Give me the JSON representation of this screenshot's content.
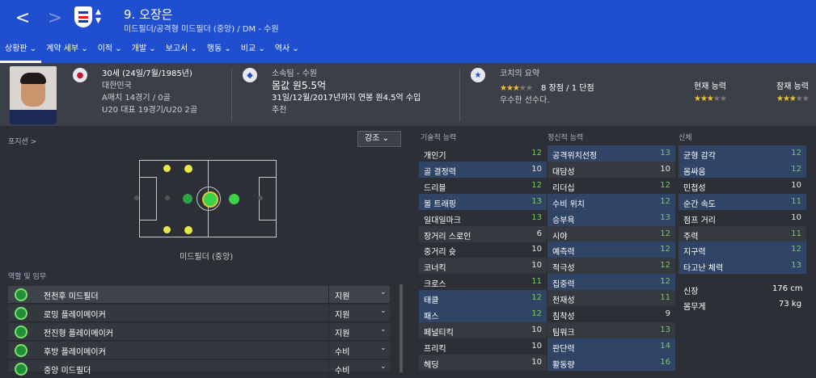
{
  "header": {
    "back_label": "<",
    "forward_label": ">",
    "chevron": "^ v",
    "player_name": "9. 오장은",
    "player_sub": "미드필더/공격형 미드필더 (중앙) / DM - 수원"
  },
  "tabs": [
    "상황판 ⌄",
    "계약 세부 ⌄",
    "이적 ⌄",
    "개발 ⌄",
    "보고서 ⌄",
    "행동 ⌄",
    "비교 ⌄",
    "역사 ⌄"
  ],
  "profile": {
    "age": "30세 (24일/7월/1985년)",
    "nation": "대한민국",
    "a_caps": "A매치 14경기 / 0골",
    "u20_caps": "U20 대표 19경기/U20 2골",
    "club_label": "소속팀 - 수원",
    "value": "몸값 원5.5억",
    "contract": "31일/12월/2017년까지 연봉 원4.5억 수입",
    "recommend": "추천"
  },
  "coach": {
    "title": "코치의 요약",
    "stars": "★★★",
    "stars_dim": "★★",
    "summary": "8 장점 / 1 단점",
    "comment": "우수한 선수다.",
    "current_ability_label": "현재 능력",
    "potential_ability_label": "잠재 능력",
    "current_stars": "★★★",
    "current_stars_dim": "★★",
    "potential_stars": "★★★",
    "potential_stars_dim": "★★"
  },
  "position": {
    "section_title": "포지션 >",
    "dropdown_label": "강조 ⌄",
    "position_label": "미드필더 (중앙)"
  },
  "roles": {
    "section_title": "역할 및 임무",
    "items": [
      {
        "name": "전천후 미드필더",
        "duty": "지원"
      },
      {
        "name": "로밍 플레이메이커",
        "duty": "지원"
      },
      {
        "name": "전진형 플레이메이커",
        "duty": "지원"
      },
      {
        "name": "후방 플레이메이커",
        "duty": "수비"
      },
      {
        "name": "중앙 미드필더",
        "duty": "수비"
      }
    ],
    "chevron": "⌄"
  },
  "technical": {
    "title": "기술적 능력",
    "attrs": [
      {
        "name": "개인기",
        "value": "12"
      },
      {
        "name": "골 결정력",
        "value": "10"
      },
      {
        "name": "드리블",
        "value": "12"
      },
      {
        "name": "볼 트래핑",
        "value": "13"
      },
      {
        "name": "일대일마크",
        "value": "13"
      },
      {
        "name": "장거리 스로인",
        "value": "6"
      },
      {
        "name": "중거리 슛",
        "value": "10"
      },
      {
        "name": "코너킥",
        "value": "10"
      },
      {
        "name": "크로스",
        "value": "11"
      },
      {
        "name": "태클",
        "value": "12"
      },
      {
        "name": "패스",
        "value": "12"
      },
      {
        "name": "페널티킥",
        "value": "10"
      },
      {
        "name": "프리킥",
        "value": "10"
      },
      {
        "name": "헤딩",
        "value": "10"
      }
    ]
  },
  "mental": {
    "title": "정신적 능력",
    "attrs": [
      {
        "name": "공격위치선정",
        "value": "13"
      },
      {
        "name": "대담성",
        "value": "10"
      },
      {
        "name": "리더십",
        "value": "12"
      },
      {
        "name": "수비 위치",
        "value": "12"
      },
      {
        "name": "승부욕",
        "value": "13"
      },
      {
        "name": "시야",
        "value": "12"
      },
      {
        "name": "예측력",
        "value": "12"
      },
      {
        "name": "적극성",
        "value": "12"
      },
      {
        "name": "집중력",
        "value": "12"
      },
      {
        "name": "천재성",
        "value": "11"
      },
      {
        "name": "침착성",
        "value": "9"
      },
      {
        "name": "팀워크",
        "value": "13"
      },
      {
        "name": "판단력",
        "value": "14"
      },
      {
        "name": "활동량",
        "value": "16"
      }
    ]
  },
  "physical": {
    "title": "신체",
    "attrs": [
      {
        "name": "균형 감각",
        "value": "12"
      },
      {
        "name": "몸싸움",
        "value": "12"
      },
      {
        "name": "민첩성",
        "value": "10"
      },
      {
        "name": "순간 속도",
        "value": "11"
      },
      {
        "name": "점프 거리",
        "value": "10"
      },
      {
        "name": "주력",
        "value": "11"
      },
      {
        "name": "지구력",
        "value": "12"
      },
      {
        "name": "타고난 체력",
        "value": "13"
      }
    ],
    "height_label": "신장",
    "height_value": "176 cm",
    "weight_label": "몸무게",
    "weight_value": "73 kg"
  },
  "colors": {
    "topbar": "#1f4fcf",
    "green_value": "#76cc5a",
    "highlight_row": "#304466"
  }
}
